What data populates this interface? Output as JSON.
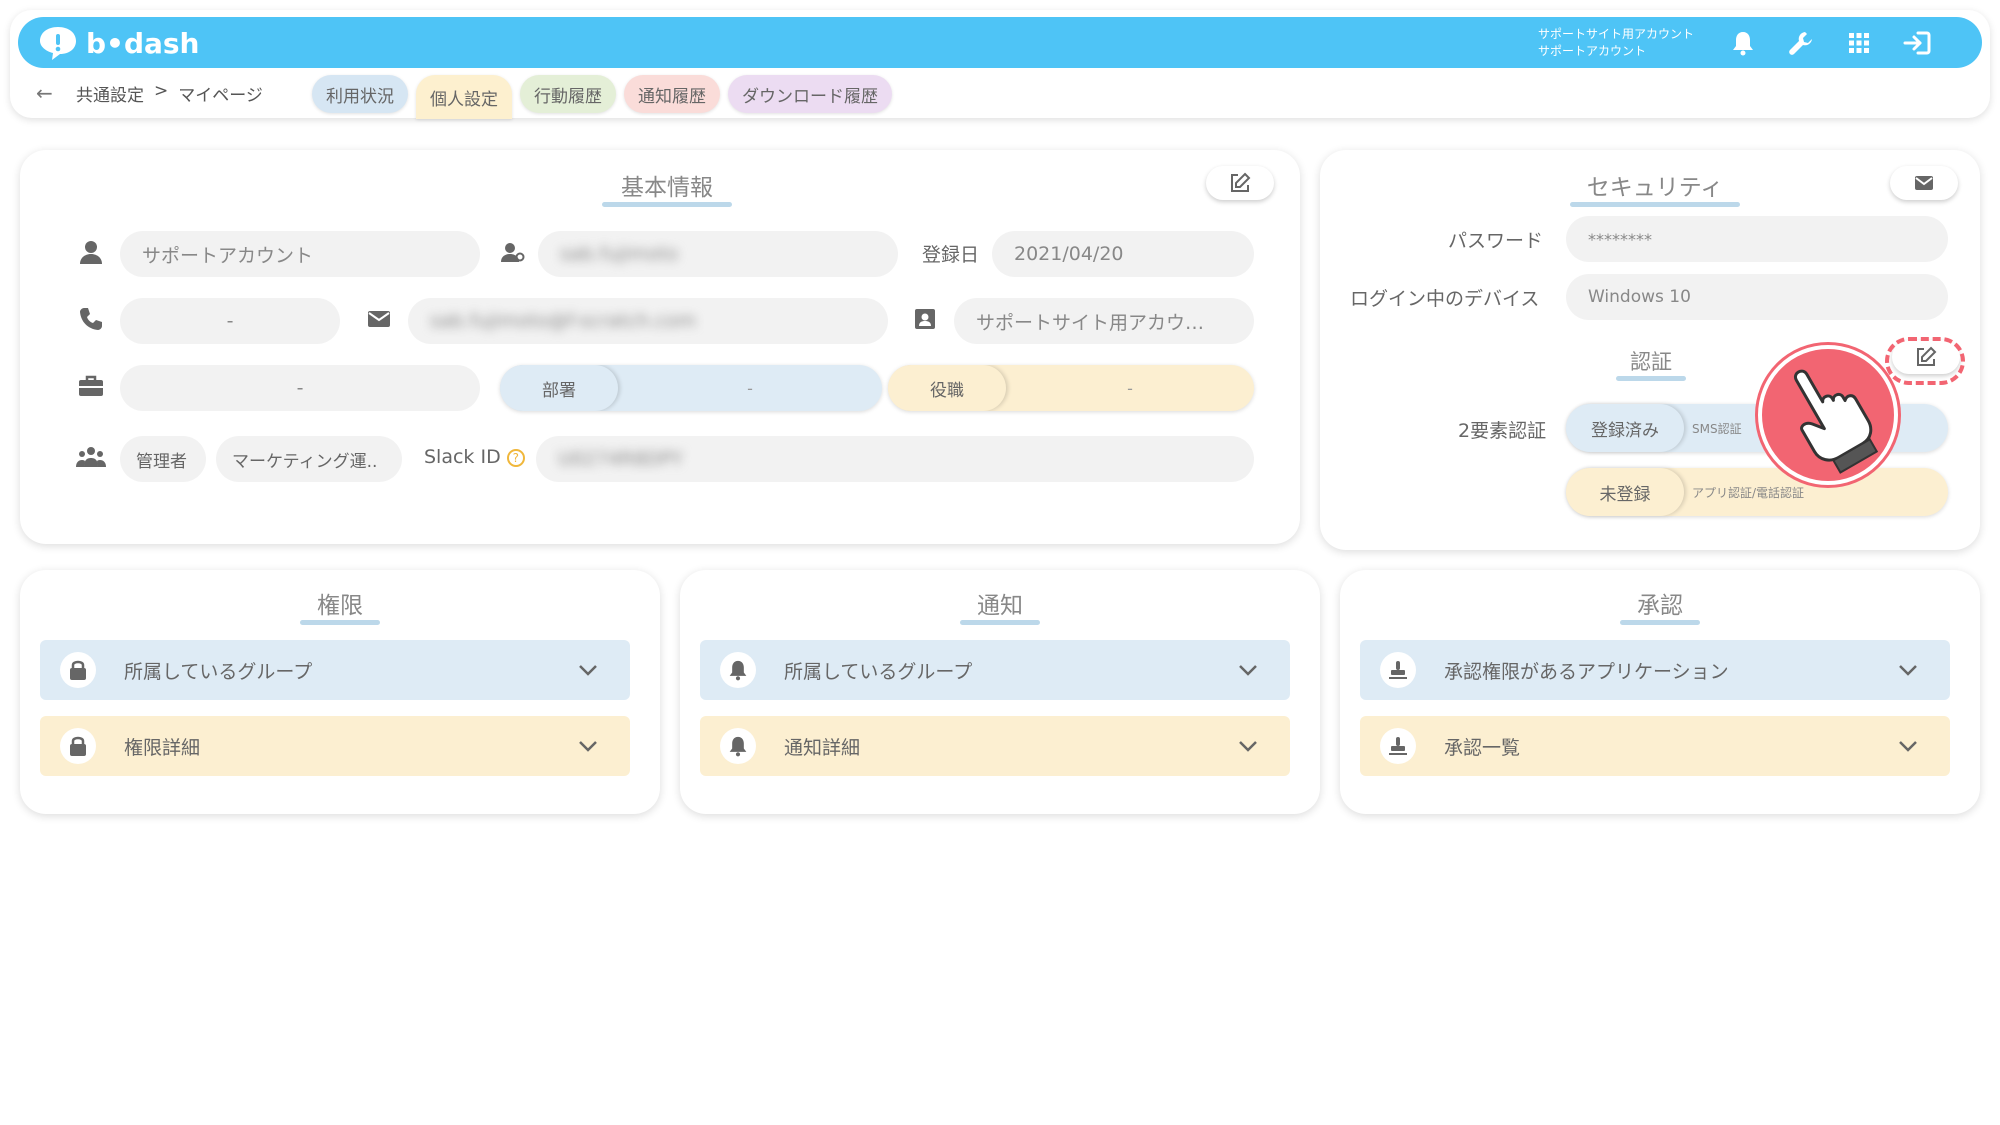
{
  "app": {
    "logo_text": "b•dash"
  },
  "topbar": {
    "account_line1": "サポートサイト用アカウント",
    "account_line2": "サポートアカウント",
    "icons": [
      "bell-icon",
      "wrench-icon",
      "grid-icon",
      "logout-icon"
    ]
  },
  "breadcrumb": {
    "parent": "共通設定",
    "separator": ">",
    "current": "マイページ"
  },
  "tabs": [
    {
      "label": "利用状況",
      "color": "#d6e6f3"
    },
    {
      "label": "個人設定",
      "color": "#fdf0cf",
      "active": true
    },
    {
      "label": "行動履歴",
      "color": "#e4efd7"
    },
    {
      "label": "通知履歴",
      "color": "#fadcd9"
    },
    {
      "label": "ダウンロード履歴",
      "color": "#ecdcf2"
    }
  ],
  "basic": {
    "title": "基本情報",
    "name": "サポートアカウント",
    "login_id": "sab.fujimoto",
    "registered_label": "登録日",
    "registered_date": "2021/04/20",
    "phone": "-",
    "email": "sab.fujimoto@f-scratch.com",
    "account_type": "サポートサイト用アカウ…",
    "company": "-",
    "dept_label": "部署",
    "dept_value": "-",
    "role_label": "役職",
    "role_value": "-",
    "group_admin": "管理者",
    "group_marketing": "マーケティング運..",
    "slack_label": "Slack ID",
    "slack_value": "U0274R8DPY"
  },
  "security": {
    "title": "セキュリティ",
    "password_label": "パスワード",
    "password_value": "********",
    "device_label": "ログイン中のデバイス",
    "device_value": "Windows 10",
    "auth_title": "認証",
    "twofa_label": "2要素認証",
    "sms_status": "登録済み",
    "sms_method": "SMS認証",
    "app_status": "未登録",
    "app_method": "アプリ認証/電話認証"
  },
  "permissions": {
    "title": "権限",
    "item1": "所属しているグループ",
    "item2": "権限詳細"
  },
  "notifications": {
    "title": "通知",
    "item1": "所属しているグループ",
    "item2": "通知詳細"
  },
  "approval": {
    "title": "承認",
    "item1": "承認権限があるアプリケーション",
    "item2": "承認一覧"
  },
  "colors": {
    "topbar": "#4ec4f6",
    "blue_row": "#deebf5",
    "yellow_row": "#fcefd1",
    "highlight": "#f26572"
  }
}
